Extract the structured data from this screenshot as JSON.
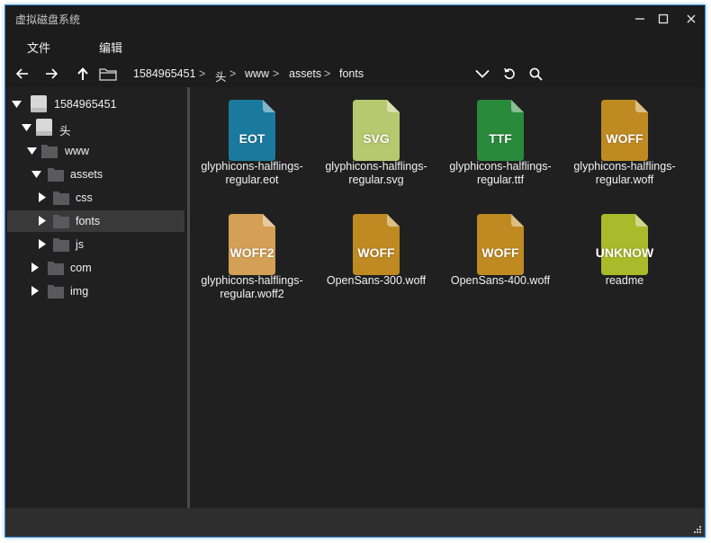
{
  "window": {
    "title": "虚拟磁盘系统"
  },
  "window_controls": {
    "minimize": "—",
    "maximize": "☐",
    "close": "✕"
  },
  "menu": {
    "items": [
      "文件",
      "编辑"
    ]
  },
  "toolbar": {
    "icons": [
      "back-arrow-icon",
      "forward-arrow-icon",
      "up-arrow-icon",
      "folder-icon",
      "chevron-down-icon",
      "refresh-icon",
      "search-icon"
    ],
    "breadcrumb": [
      "1584965451",
      "头",
      "www",
      "assets",
      "fonts"
    ],
    "separator": ">"
  },
  "tree": {
    "items": [
      {
        "label": "1584965451",
        "expanded": true,
        "icon": "drive-icon",
        "level": 0
      },
      {
        "label": "头",
        "expanded": true,
        "icon": "drive-icon",
        "level": 1
      },
      {
        "label": "www",
        "expanded": true,
        "icon": "folder-icon",
        "level": 2
      },
      {
        "label": "assets",
        "expanded": true,
        "icon": "folder-icon",
        "level": 3
      },
      {
        "label": "css",
        "expanded": false,
        "icon": "folder-icon",
        "level": 4
      },
      {
        "label": "fonts",
        "expanded": false,
        "icon": "folder-icon",
        "level": 4,
        "selected": true
      },
      {
        "label": "js",
        "expanded": false,
        "icon": "folder-icon",
        "level": 4
      },
      {
        "label": "com",
        "expanded": false,
        "icon": "folder-icon",
        "level": 3
      },
      {
        "label": "img",
        "expanded": false,
        "icon": "folder-icon",
        "level": 3
      }
    ]
  },
  "files": [
    {
      "name": "glyphicons-halflings-regular.eot",
      "ext": "EOT",
      "color": "#1a7a9e"
    },
    {
      "name": "glyphicons-halflings-regular.svg",
      "ext": "SVG",
      "color": "#b8c86e"
    },
    {
      "name": "glyphicons-halflings-regular.ttf",
      "ext": "TTF",
      "color": "#2a8a3c"
    },
    {
      "name": "glyphicons-halflings-regular.woff",
      "ext": "WOFF",
      "color": "#c08a22"
    },
    {
      "name": "glyphicons-halflings-regular.woff2",
      "ext": "WOFF2",
      "color": "#d4a055"
    },
    {
      "name": "OpenSans-300.woff",
      "ext": "WOFF",
      "color": "#c08a22"
    },
    {
      "name": "OpenSans-400.woff",
      "ext": "WOFF",
      "color": "#c08a22"
    },
    {
      "name": "readme",
      "ext": "UNKNOW",
      "color": "#a9bb2a"
    }
  ],
  "theme": {
    "background": "#202020",
    "accent_border": "#3b8fd6",
    "folder": "#5a5a5e"
  }
}
